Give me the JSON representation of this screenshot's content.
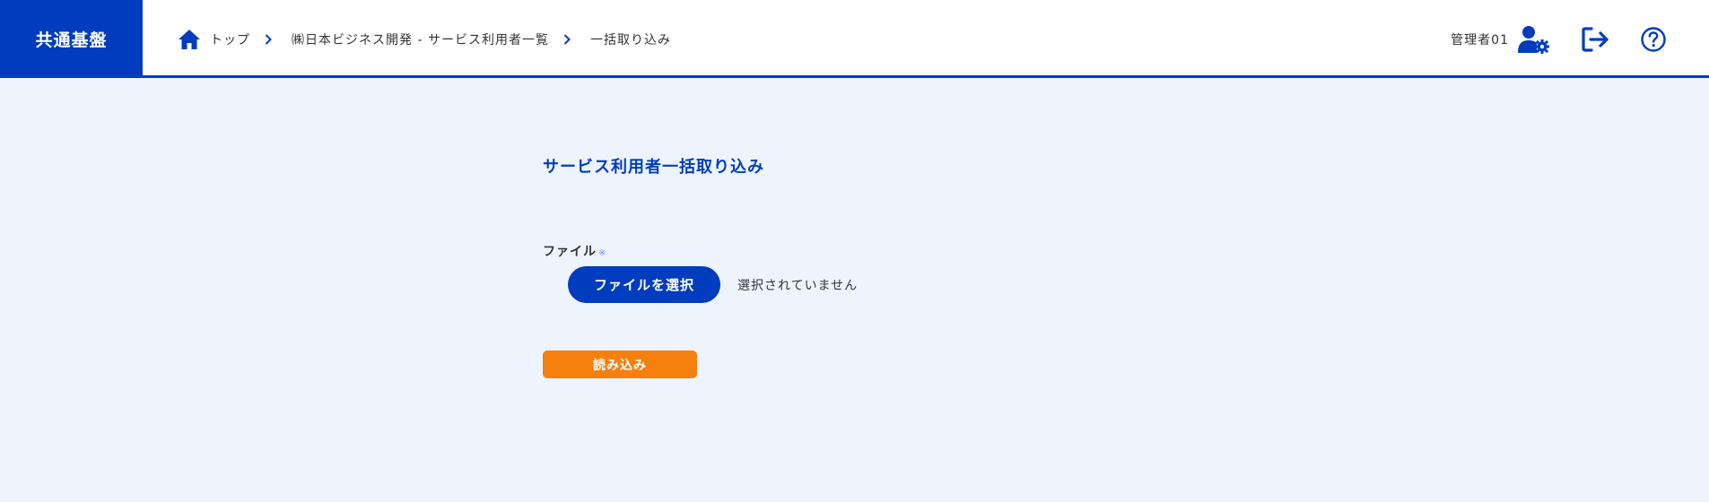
{
  "header": {
    "brand": "共通基盤",
    "breadcrumb": [
      {
        "label": "トップ"
      },
      {
        "label": "㈱日本ビジネス開発 - サービス利用者一覧"
      },
      {
        "label": "一括取り込み"
      }
    ],
    "user_name": "管理者01",
    "icons": {
      "home": "home-icon",
      "separator": "chevron-right-icon",
      "user_settings": "user-gear-icon",
      "logout": "logout-icon",
      "help": "question-circle-icon"
    }
  },
  "main": {
    "title": "サービス利用者一括取り込み",
    "file_field": {
      "label": "ファイル",
      "required_mark": "※",
      "button_label": "ファイルを選択",
      "status": "選択されていません"
    },
    "load_button_label": "読み込み"
  },
  "colors": {
    "primary": "#003cbe",
    "accent_orange": "#f5800d",
    "background": "#eef4fe",
    "header_bg": "#ffffff",
    "text": "#333333"
  }
}
